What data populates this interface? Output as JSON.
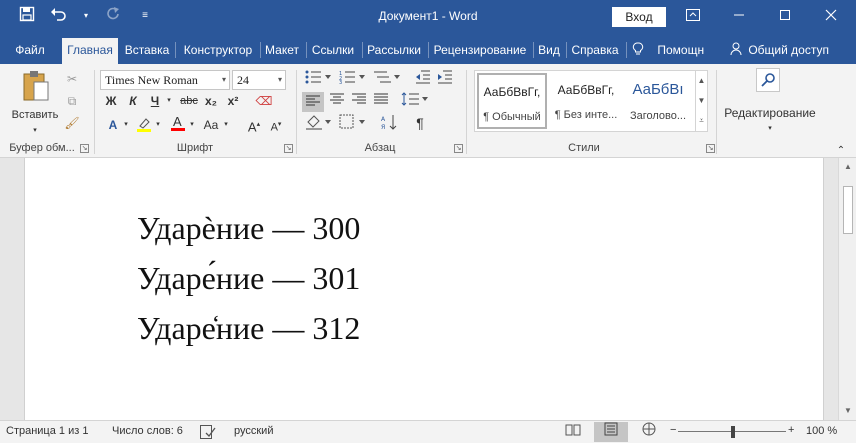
{
  "qat": {
    "save_icon": "save-icon",
    "undo_icon": "undo-icon",
    "redo_icon": "redo-icon",
    "customize_icon": "customize-qat-icon"
  },
  "window": {
    "title": "Документ1  -  Word",
    "signin_label": "Вход",
    "ribbon_display_icon": "ribbon-display-icon",
    "minimize_icon": "minimize-icon",
    "maximize_icon": "maximize-icon",
    "close_icon": "close-icon"
  },
  "tabs": [
    {
      "label": "Файл"
    },
    {
      "label": "Главная"
    },
    {
      "label": "Вставка"
    },
    {
      "label": "Конструктор"
    },
    {
      "label": "Макет"
    },
    {
      "label": "Ссылки"
    },
    {
      "label": "Рассылки"
    },
    {
      "label": "Рецензирование"
    },
    {
      "label": "Вид"
    },
    {
      "label": "Справка"
    },
    {
      "label": "Помощн"
    },
    {
      "label": "Общий доступ"
    }
  ],
  "ribbon": {
    "clipboard": {
      "paste_label": "Вставить",
      "group_label": "Буфер обм..."
    },
    "font": {
      "font_name": "Times New Roman",
      "font_size": "24",
      "bold": "Ж",
      "italic": "К",
      "underline": "Ч",
      "strike": "abc",
      "subscript": "x₂",
      "superscript": "x²",
      "change_case": "Aa",
      "grow": "A",
      "shrink": "A",
      "group_label": "Шрифт"
    },
    "paragraph": {
      "group_label": "Абзац"
    },
    "styles": {
      "items": [
        {
          "sample": "АаБбВвГг,",
          "name": "¶ Обычный"
        },
        {
          "sample": "АаБбВвГг,",
          "name": "¶ Без инте..."
        },
        {
          "sample": "АаБбВı",
          "name": "Заголово..."
        }
      ],
      "group_label": "Стили"
    },
    "editing": {
      "label": "Редактирование"
    }
  },
  "document": {
    "lines": [
      "Ударѐние — 300",
      "Ударе́ние — 301",
      "Ударе̒ние — 312"
    ]
  },
  "status": {
    "page": "Страница 1 из 1",
    "words": "Число слов: 6",
    "language": "русский",
    "zoom": "100 %",
    "zoom_level_percent": 100
  },
  "colors": {
    "brand": "#2b579a",
    "highlight": "#ffff00",
    "font_color": "#ff0000"
  }
}
